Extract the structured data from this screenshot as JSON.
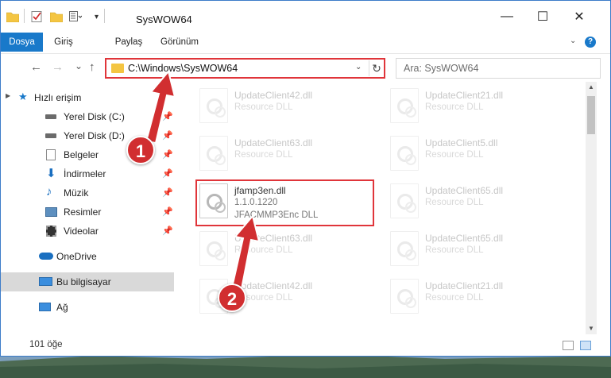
{
  "window": {
    "title": "SysWOW64",
    "minimize": "—",
    "maximize": "☐",
    "close": "✕"
  },
  "ribbon": {
    "tabs": [
      "Dosya",
      "Giriş",
      "Paylaş",
      "Görünüm"
    ],
    "help": "?"
  },
  "nav": {
    "back": "←",
    "forward": "→",
    "recent": "⌄",
    "up": "↑",
    "address": "C:\\Windows\\SysWOW64",
    "dropdown": "⌄",
    "refresh": "↻",
    "search_placeholder": "Ara: SysWOW64"
  },
  "sidebar": {
    "quick_access": "Hızlı erişim",
    "items": [
      {
        "label": "Yerel Disk (C:)",
        "icon": "drive-icon"
      },
      {
        "label": "Yerel Disk (D:)",
        "icon": "drive-icon"
      },
      {
        "label": "Belgeler",
        "icon": "documents-icon"
      },
      {
        "label": "İndirmeler",
        "icon": "download-icon"
      },
      {
        "label": "Müzik",
        "icon": "music-icon"
      },
      {
        "label": "Resimler",
        "icon": "pictures-icon"
      },
      {
        "label": "Videolar",
        "icon": "videos-icon"
      }
    ],
    "onedrive": "OneDrive",
    "this_pc": "Bu bilgisayar",
    "network": "Ağ"
  },
  "files": {
    "left": [
      {
        "name": "UpdateClient42.dll",
        "type": "Resource DLL"
      },
      {
        "name": "UpdateClient63.dll",
        "type": "Resource DLL"
      },
      {
        "name": "jfamp3en.dll",
        "version": "1.1.0.1220",
        "type": "JFACMMP3Enc DLL"
      },
      {
        "name": "UpdateClient63.dll",
        "type": "Resource DLL"
      },
      {
        "name": "UpdateClient42.dll",
        "type": "Resource DLL"
      }
    ],
    "right": [
      {
        "name": "UpdateClient21.dll",
        "type": "Resource DLL"
      },
      {
        "name": "UpdateClient5.dll",
        "type": "Resource DLL"
      },
      {
        "name": "UpdateClient65.dll",
        "type": "Resource DLL"
      },
      {
        "name": "UpdateClient65.dll",
        "type": "Resource DLL"
      },
      {
        "name": "UpdateClient21.dll",
        "type": "Resource DLL"
      }
    ]
  },
  "status": {
    "count": "101 öğe"
  },
  "callouts": [
    "1",
    "2"
  ],
  "colors": {
    "accent": "#1979ca",
    "highlight": "#e0353a",
    "callout": "#d12e30",
    "selection": "#d9d9d9"
  }
}
